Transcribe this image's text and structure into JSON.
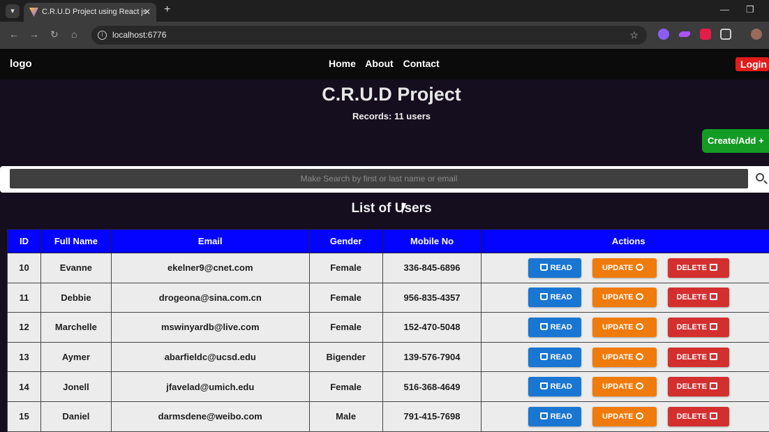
{
  "browser": {
    "tab_title": "C.R.U.D Project using React js",
    "url": "localhost:6776"
  },
  "nav": {
    "logo": "logo",
    "links": [
      "Home",
      "About",
      "Contact"
    ],
    "login": "Login"
  },
  "hero": {
    "title": "C.R.U.D Project",
    "records": "Records: 11 users",
    "create_label": "Create/Add +"
  },
  "search": {
    "placeholder": "Make Search by first or last name or email"
  },
  "list_title": "List of Users",
  "table": {
    "headers": [
      "ID",
      "Full Name",
      "Email",
      "Gender",
      "Mobile No",
      "Actions"
    ],
    "rows": [
      {
        "id": "10",
        "name": "Evanne",
        "email": "ekelner9@cnet.com",
        "gender": "Female",
        "mobile": "336-845-6896"
      },
      {
        "id": "11",
        "name": "Debbie",
        "email": "drogeona@sina.com.cn",
        "gender": "Female",
        "mobile": "956-835-4357"
      },
      {
        "id": "12",
        "name": "Marchelle",
        "email": "mswinyardb@live.com",
        "gender": "Female",
        "mobile": "152-470-5048"
      },
      {
        "id": "13",
        "name": "Aymer",
        "email": "abarfieldc@ucsd.edu",
        "gender": "Bigender",
        "mobile": "139-576-7904"
      },
      {
        "id": "14",
        "name": "Jonell",
        "email": "jfavelad@umich.edu",
        "gender": "Female",
        "mobile": "516-368-4649"
      },
      {
        "id": "15",
        "name": "Daniel",
        "email": "darmsdene@weibo.com",
        "gender": "Male",
        "mobile": "791-415-7698"
      }
    ],
    "actions": {
      "read": "READ",
      "update": "UPDATE",
      "delete": "DELETE"
    }
  },
  "colors": {
    "header_bg": "#0303ff",
    "read": "#1976d2",
    "update": "#ef7b0c",
    "delete": "#d32f2f",
    "create": "#139b24",
    "login": "#e21b1b"
  }
}
